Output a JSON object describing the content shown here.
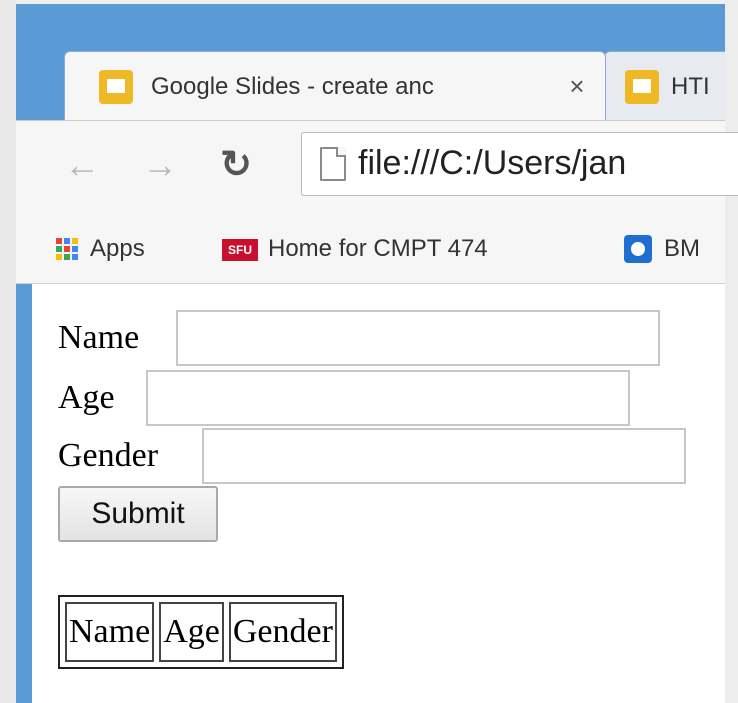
{
  "browser": {
    "tabs": [
      {
        "title": "Google Slides - create anc",
        "icon": "google-slides-icon",
        "active": true
      },
      {
        "title": "HTI",
        "icon": "google-slides-icon",
        "active": false
      }
    ],
    "close_glyph": "×",
    "url": "file:///C:/Users/jan",
    "bookmarks": [
      {
        "label": "Apps",
        "icon": "apps-grid-icon"
      },
      {
        "label": "Home for CMPT 474",
        "icon": "sfu-icon",
        "icon_text": "SFU"
      },
      {
        "label": "BM",
        "icon": "bookmark-app-icon"
      }
    ]
  },
  "form": {
    "name_label": "Name",
    "age_label": "Age",
    "gender_label": "Gender",
    "name_value": "",
    "age_value": "",
    "gender_value": "",
    "submit_label": "Submit"
  },
  "table": {
    "headers": [
      "Name",
      "Age",
      "Gender"
    ]
  },
  "colors": {
    "window_frame": "#5b9bd5",
    "tab_favicon": "#efb825",
    "sfu_red": "#c8102e"
  }
}
